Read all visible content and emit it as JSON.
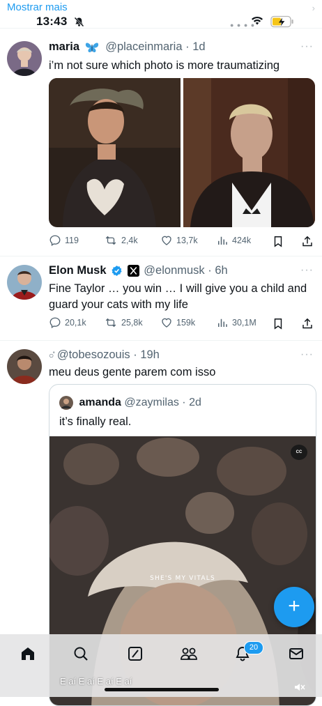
{
  "status_bar": {
    "show_more": "Mostrar mais",
    "time": "13:43"
  },
  "tweets": [
    {
      "name": "maria",
      "handle": "@placeinmaria",
      "time": "1d",
      "text": "i’m not sure which photo is more traumatizing",
      "stats": {
        "replies": "119",
        "retweets": "2,4k",
        "likes": "13,7k",
        "views": "424k"
      }
    },
    {
      "name": "Elon Musk",
      "handle": "@elonmusk",
      "time": "6h",
      "text": "Fine Taylor … you win … I will give you a child and guard your cats with my life",
      "stats": {
        "replies": "20,1k",
        "retweets": "25,8k",
        "likes": "159k",
        "views": "30,1M"
      }
    },
    {
      "name": "",
      "handle": "@tobesozouis",
      "time": "19h",
      "text": "meu deus gente parem com isso",
      "quote": {
        "name": "amanda",
        "handle": "@zaymilas",
        "time": "2d",
        "text": "it’s finally real.",
        "video_caption": "SHE'S MY VITALS",
        "cc_label": "CC"
      }
    }
  ],
  "bottom_nav": {
    "notification_badge": "20",
    "marquee": "E aí E aí E aí E aí"
  },
  "colors": {
    "accent": "#1d9bf0",
    "text": "#0f1419",
    "secondary": "#536471"
  },
  "icons": [
    "home-icon",
    "search-icon",
    "grok-icon",
    "communities-icon",
    "notifications-icon",
    "messages-icon",
    "compose-icon",
    "reply-icon",
    "retweet-icon",
    "like-icon",
    "views-icon",
    "bookmark-icon",
    "share-icon",
    "verified-icon"
  ]
}
